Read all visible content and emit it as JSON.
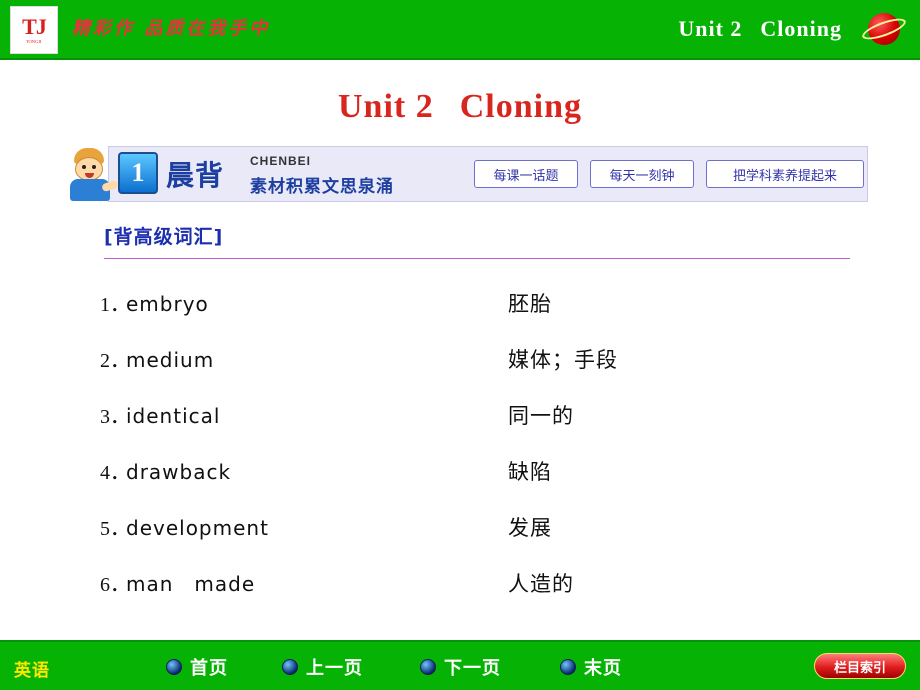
{
  "header": {
    "logo_mark": "TJ",
    "logo_sub": "TONGJI",
    "brand_script": "精彩作  品质在我手中",
    "unit_number": "Unit 2",
    "unit_name": "Cloning",
    "planet_icon": "planet-icon"
  },
  "title": {
    "unit_number": "Unit 2",
    "unit_name": "Cloning"
  },
  "banner": {
    "badge_number": "1",
    "badge_label_cn": "晨背",
    "pinyin": "CHENBEI",
    "slogan": "素材积累文思泉涌",
    "chips": [
      "每课一话题",
      "每天一刻钟",
      "把学科素养提起来"
    ],
    "boy_icon": "cartoon-boy-icon"
  },
  "section": {
    "heading": "[背高级词汇]"
  },
  "vocabulary": [
    {
      "num": "1．",
      "en": "embryo",
      "cn": "胚胎"
    },
    {
      "num": "2．",
      "en": "medium",
      "cn": "媒体；手段"
    },
    {
      "num": "3．",
      "en": "identical",
      "cn": "同一的"
    },
    {
      "num": "4．",
      "en": "drawback",
      "cn": "缺陷"
    },
    {
      "num": "5．",
      "en": "development",
      "cn": "发展"
    },
    {
      "num": "6．",
      "en": "man　made",
      "cn": "人造的"
    }
  ],
  "footer": {
    "subject": "英语",
    "nav": [
      "首页",
      "上一页",
      "下一页",
      "末页"
    ],
    "index_button": "栏目索引"
  },
  "colors": {
    "bar_green": "#06b305",
    "title_red": "#d8251d",
    "heading_blue": "#1c2fae",
    "rule_purple": "#c05ad0",
    "chip_border": "#6f6fd0",
    "footer_yellow": "#ffe600"
  }
}
